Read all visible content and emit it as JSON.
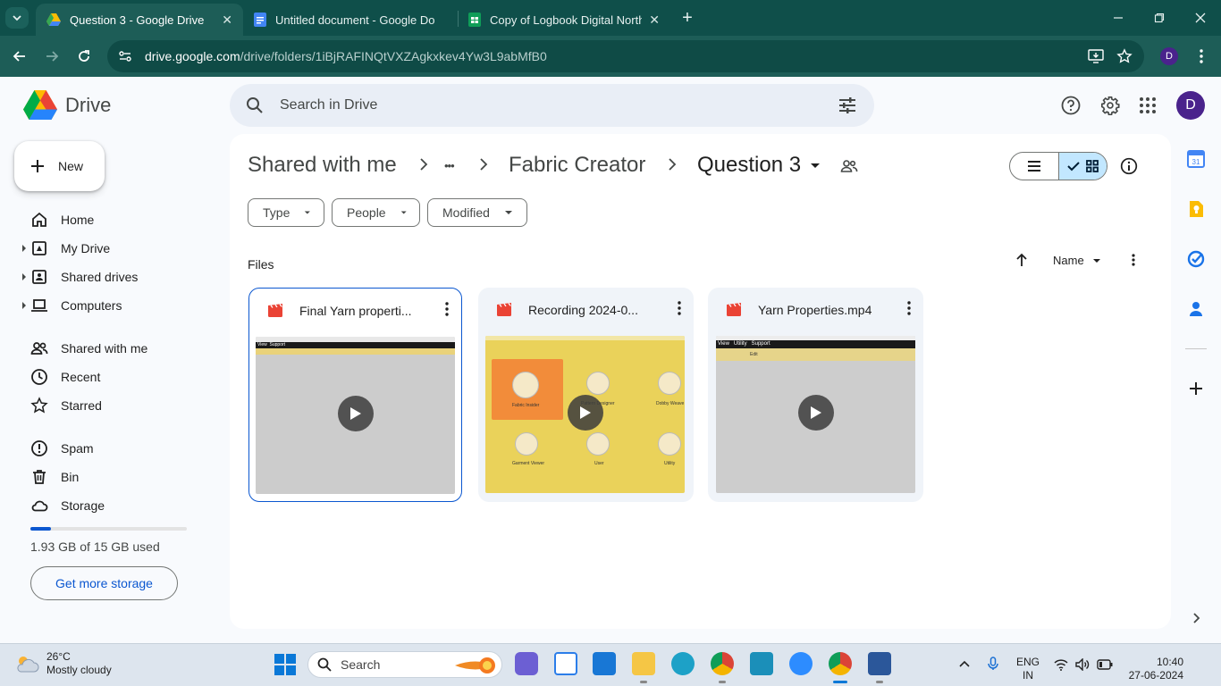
{
  "browser": {
    "tabs": [
      {
        "title": "Question 3 - Google Drive",
        "icon": "drive-favicon",
        "active": true
      },
      {
        "title": "Untitled document - Google Do",
        "icon": "docs-favicon",
        "active": false
      },
      {
        "title": "Copy of Logbook Digital North",
        "icon": "sheets-favicon",
        "active": false
      }
    ],
    "url_host": "drive.google.com",
    "url_path": "/drive/folders/1iBjRAFINQtVXZAgkxkev4Yw3L9abMfB0",
    "profile_initial": "D"
  },
  "drive": {
    "app_name": "Drive",
    "search_placeholder": "Search in Drive",
    "avatar_initial": "D",
    "new_label": "New",
    "nav": [
      {
        "label": "Home",
        "icon": "home-icon"
      },
      {
        "label": "My Drive",
        "icon": "my-drive-icon"
      },
      {
        "label": "Shared drives",
        "icon": "shared-drives-icon"
      },
      {
        "label": "Computers",
        "icon": "computer-icon"
      },
      {
        "label": "Shared with me",
        "icon": "people-icon"
      },
      {
        "label": "Recent",
        "icon": "clock-icon"
      },
      {
        "label": "Starred",
        "icon": "star-icon"
      },
      {
        "label": "Spam",
        "icon": "spam-icon"
      },
      {
        "label": "Bin",
        "icon": "bin-icon"
      },
      {
        "label": "Storage",
        "icon": "cloud-icon"
      }
    ],
    "storage": {
      "used_text": "1.93 GB of 15 GB used",
      "fraction_used": 0.129,
      "button": "Get more storage"
    },
    "breadcrumb": {
      "root": "Shared with me",
      "ellipsis": "•••",
      "parent": "Fabric Creator",
      "current": "Question 3"
    },
    "filters": [
      "Type",
      "People",
      "Modified"
    ],
    "files_heading": "Files",
    "sort_label": "Name",
    "files": [
      {
        "name": "Final Yarn properti...",
        "type": "video",
        "selected": true,
        "thumbnail": "grey-screen"
      },
      {
        "name": "Recording 2024-0...",
        "type": "video",
        "selected": false,
        "thumbnail": "yellow-app-menu"
      },
      {
        "name": "Yarn Properties.mp4",
        "type": "video",
        "selected": false,
        "thumbnail": "grey-screen"
      }
    ],
    "thumb_labels": {
      "menu1_view": "View",
      "menu1_support": "Support",
      "menu3_view": "View",
      "menu3_utility": "Utility",
      "menu3_support": "Support",
      "menu3_edit": "Edit",
      "rec_fabric": "Fabric Insider",
      "rec_pattern": "Pattern Designer",
      "rec_dobby": "Dobby Weave",
      "rec_garment": "Garment Viewer",
      "rec_user": "User",
      "rec_utility": "Utility"
    }
  },
  "taskbar": {
    "weather_temp": "26°C",
    "weather_desc": "Mostly cloudy",
    "search_label": "Search",
    "lang_line1": "ENG",
    "lang_line2": "IN",
    "time": "10:40",
    "date": "27-06-2024"
  },
  "colors": {
    "chrome_dark": "#0f4f4a",
    "chrome_mid": "#1d5d57",
    "drive_blue": "#0b57d0",
    "selected_view": "#c2e7ff",
    "video_red": "#ea4335"
  }
}
